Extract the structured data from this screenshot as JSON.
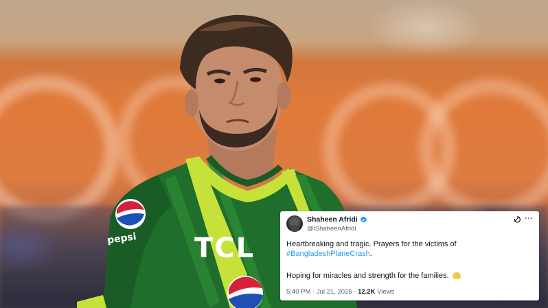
{
  "tweet": {
    "display_name": "Shaheen Afridi",
    "handle": "@iShaheenAfridi",
    "text_line1": "Heartbreaking and tragic. Prayers for the victims of",
    "hashtag": "#BangladeshPlaneCrash",
    "hashtag_trailing": ".",
    "text_line2": "Hoping for miracles and strength for the families.",
    "emoji_name": "folded-hands-emoji",
    "time": "5:40 PM",
    "separator": " · ",
    "date": "Jul 21, 2025",
    "views_count": "12.2K",
    "views_label": "Views",
    "more_label": "···",
    "link_color": "#1d9bf0",
    "verified_color": "#1d9bf0"
  },
  "jersey": {
    "sponsor": "TCL",
    "brand": "pepsi",
    "color": "#1f6e2c",
    "stripe_color": "#c6e23a"
  },
  "icons": [
    "verified-badge-icon",
    "grok-icon",
    "more-options-icon",
    "pepsi-logo-icon"
  ]
}
